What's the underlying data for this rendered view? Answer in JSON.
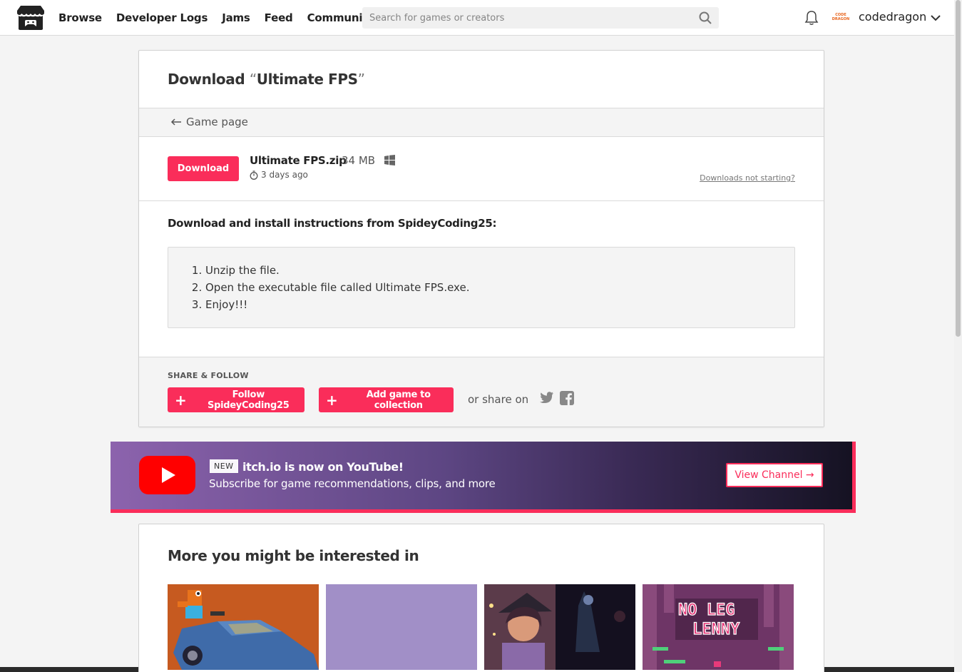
{
  "header": {
    "nav": [
      "Browse",
      "Developer Logs",
      "Jams",
      "Feed",
      "Community"
    ],
    "search_placeholder": "Search for games or creators",
    "avatar_text": "CODE DRAGON",
    "username": "codedragon"
  },
  "download": {
    "title_prefix": "Download ",
    "open_quote": "“",
    "game_name": "Ultimate FPS",
    "close_quote": "”",
    "back_label": "Game page",
    "button_label": "Download",
    "file_name": "Ultimate FPS.zip",
    "file_size": "34 MB",
    "platform_icon": "windows-icon",
    "uploaded": "3 days ago",
    "not_starting": "Downloads not starting?"
  },
  "instructions": {
    "title": "Download and install instructions from SpideyCoding25:",
    "steps": [
      "Unzip the file.",
      "Open the executable file called Ultimate FPS.exe.",
      "Enjoy!!!"
    ]
  },
  "share": {
    "label": "SHARE & FOLLOW",
    "follow_label": "Follow SpideyCoding25",
    "collection_label": "Add game to collection",
    "or_share": "or share on"
  },
  "youtube": {
    "badge": "NEW",
    "title": "itch.io is now on YouTube!",
    "subtitle": "Subscribe for game recommendations, clips, and more",
    "button": "View Channel →"
  },
  "more": {
    "title": "More you might be interested in",
    "thumb4_text_line1": "NO LEG",
    "thumb4_text_line2": "LENNY"
  },
  "colors": {
    "accent": "#fa2d5a",
    "background": "#f4f4f4"
  }
}
